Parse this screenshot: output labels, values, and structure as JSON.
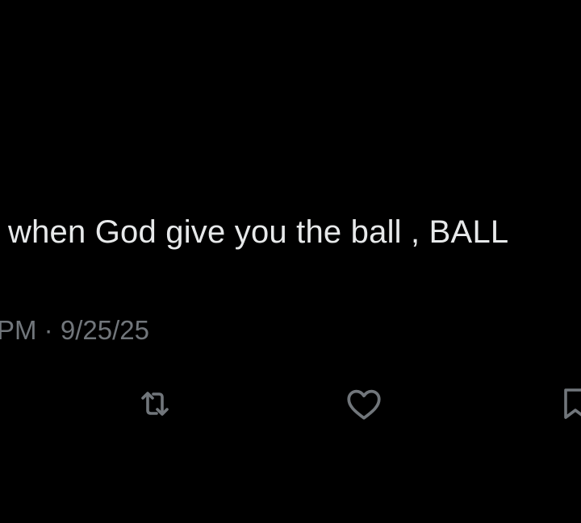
{
  "tweet": {
    "text": "when God give you the ball , BALL",
    "time_partial": "PM",
    "separator": "·",
    "date": "9/25/25"
  },
  "actions": [
    {
      "icon": "retweet-icon"
    },
    {
      "icon": "heart-icon"
    },
    {
      "icon": "bookmark-icon"
    }
  ],
  "colors": {
    "background": "#000000",
    "text": "#e7e9ea",
    "secondary": "#71767b"
  }
}
